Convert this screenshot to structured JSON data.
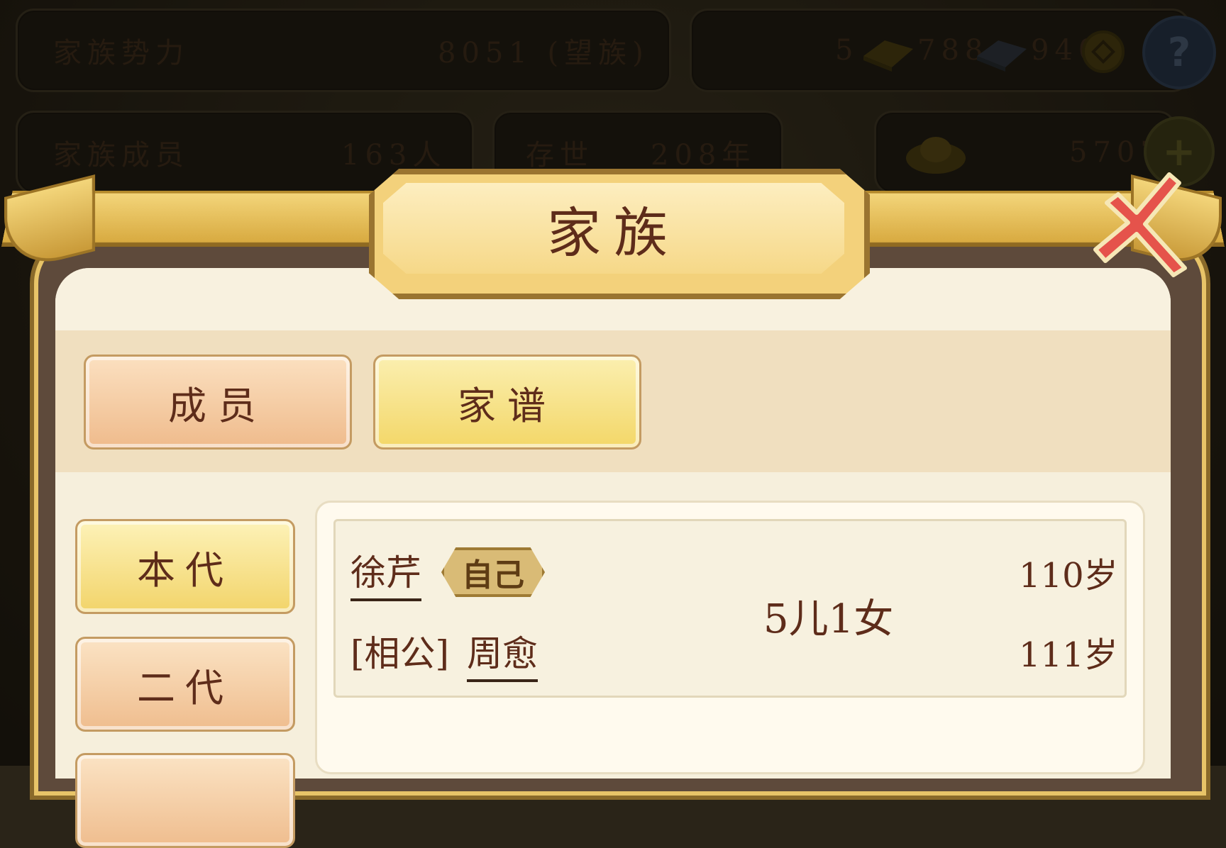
{
  "hud": {
    "clan_power_label": "家族势力",
    "clan_power_value": "8051 (望族)",
    "resource_gold": "5",
    "resource_silver": "788",
    "resource_coin": "940",
    "help_label": "?",
    "clan_members_label": "家族成员",
    "clan_members_value": "163人",
    "years_label": "存世",
    "years_value": "208年",
    "ingot_value": "5707",
    "plus_label": "+"
  },
  "modal": {
    "title": "家族",
    "tabs": [
      {
        "label": "成员"
      },
      {
        "label": "家谱"
      }
    ],
    "generations": [
      {
        "label": "本代"
      },
      {
        "label": "二代"
      }
    ],
    "entry": {
      "self_name": "徐芹",
      "self_badge": "自己",
      "self_age": "110岁",
      "spouse_prefix": "[相公]",
      "spouse_name": "周愈",
      "spouse_age": "111岁",
      "children": "5儿1女"
    }
  },
  "colors": {
    "text_dark": "#5e2c1a",
    "gold": "#f3d17b",
    "close_red": "#e5534b"
  }
}
